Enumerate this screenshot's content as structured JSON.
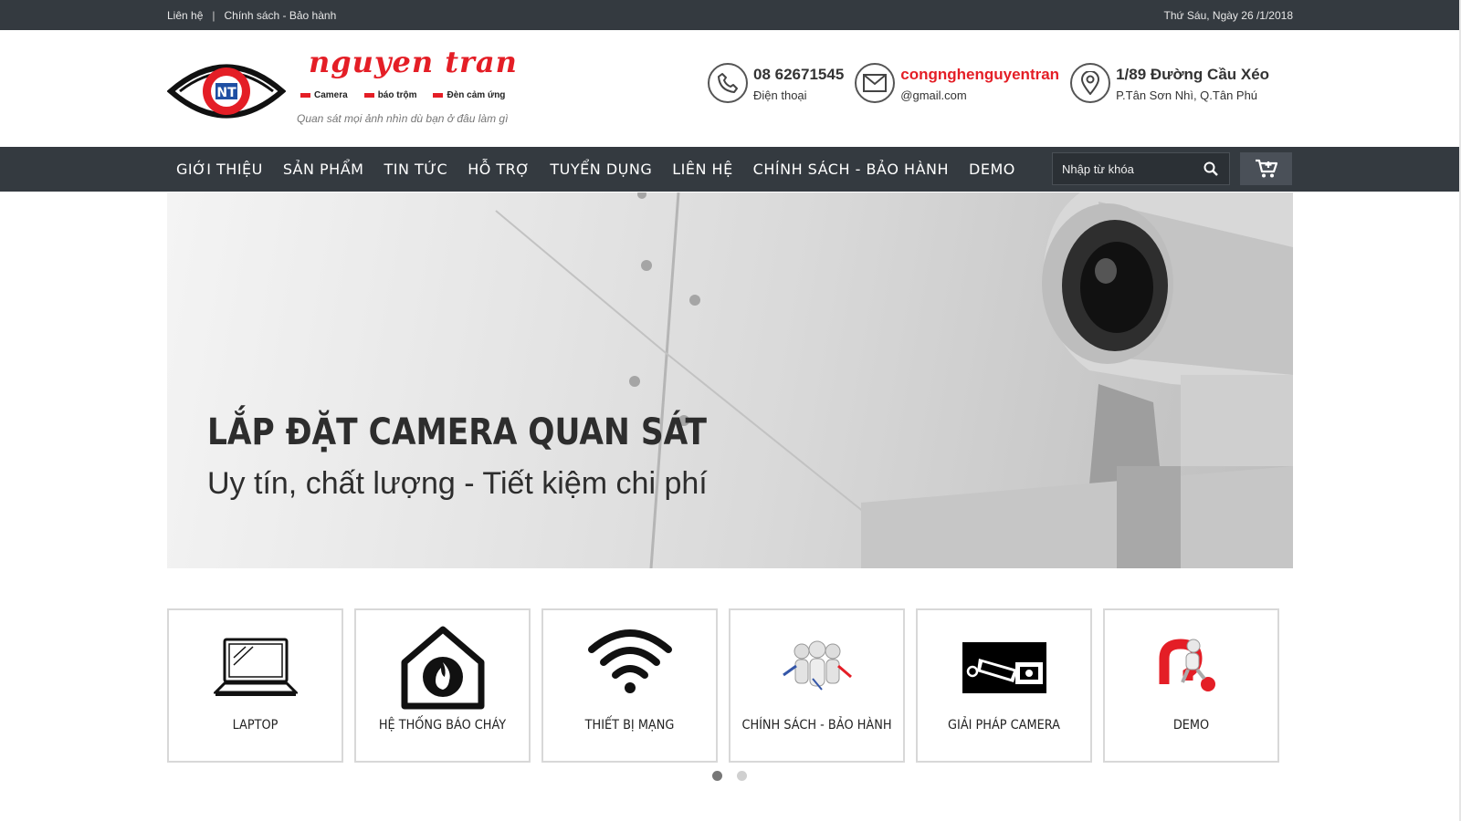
{
  "topbar": {
    "links": [
      "Liên hệ",
      "Chính sách - Bảo hành"
    ],
    "date": "Thứ Sáu, Ngày 26 /1/2018"
  },
  "logo": {
    "brand": "nguyen tran",
    "tags": [
      "Camera",
      "báo trộm",
      "Đèn cảm ứng"
    ],
    "slogan": "Quan sát mọi ảnh nhìn dù bạn ở đâu làm gì"
  },
  "contacts": [
    {
      "icon": "phone-icon",
      "main": "08 62671545",
      "sub": "Điện thoại"
    },
    {
      "icon": "mail-icon",
      "main": "congnghenguyentran",
      "sub": "@gmail.com"
    },
    {
      "icon": "location-pin-icon",
      "main": "1/89 Đường Cầu Xéo",
      "sub": "P.Tân Sơn Nhì, Q.Tân Phú"
    }
  ],
  "nav": {
    "items": [
      "GIỚI THIỆU",
      "SẢN PHẨM",
      "TIN TỨC",
      "HỖ TRỢ",
      "TUYỂN DỤNG",
      "LIÊN HỆ",
      "CHÍNH SÁCH - BẢO HÀNH",
      "DEMO"
    ],
    "search_placeholder": "Nhập từ khóa"
  },
  "banner": {
    "headline": "LẮP ĐẶT CAMERA QUAN SÁT",
    "subheadline": "Uy tín, chất lượng - Tiết kiệm chi phí"
  },
  "categories": [
    {
      "label": "LAPTOP",
      "icon": "laptop-icon"
    },
    {
      "label": "HỆ THỐNG BÁO CHÁY",
      "icon": "fire-alarm-house-icon"
    },
    {
      "label": "THIẾT BỊ MẠNG",
      "icon": "wifi-icon"
    },
    {
      "label": "CHÍNH SÁCH - BẢO HÀNH",
      "icon": "team-figures-icon"
    },
    {
      "label": "GIẢI PHÁP CAMERA",
      "icon": "cctv-camera-icon"
    },
    {
      "label": "DEMO",
      "icon": "question-mark-figure-icon"
    }
  ],
  "carousel": {
    "pages": 2,
    "active": 1
  },
  "colors": {
    "brand_red": "#e41e26",
    "bar_dark": "#343a40"
  }
}
